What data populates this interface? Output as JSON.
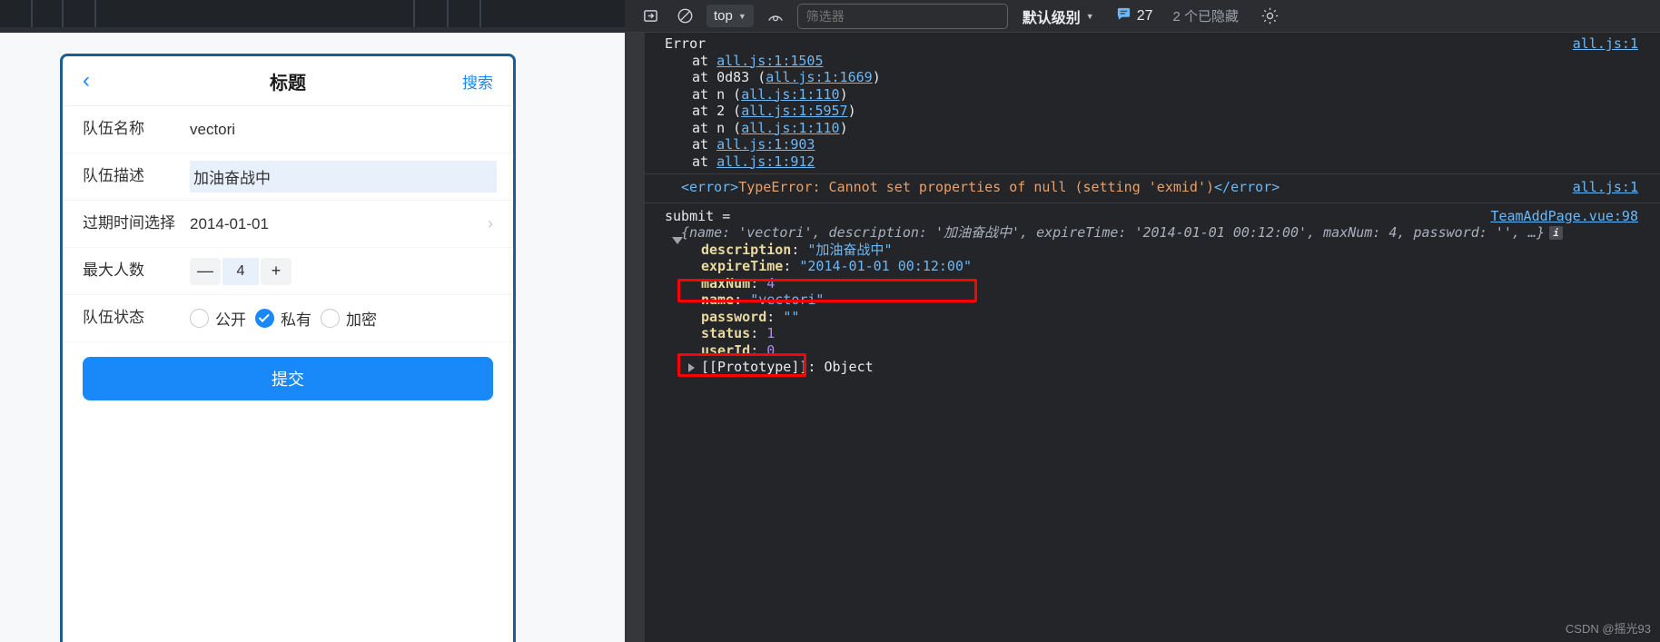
{
  "app": {
    "nav": {
      "back_icon": "chevron-left-icon",
      "title": "标题",
      "action": "搜索"
    },
    "fields": [
      {
        "label": "队伍名称",
        "value": "vectori"
      },
      {
        "label": "队伍描述",
        "value": "加油奋战中"
      },
      {
        "label": "过期时间选择",
        "value": "2014-01-01"
      },
      {
        "label": "最大人数",
        "value": "4"
      },
      {
        "label": "队伍状态"
      }
    ],
    "stepper": {
      "minus": "—",
      "plus": "+",
      "value": "4"
    },
    "status_options": [
      {
        "label": "公开",
        "checked": false
      },
      {
        "label": "私有",
        "checked": true
      },
      {
        "label": "加密",
        "checked": false
      }
    ],
    "submit_label": "提交",
    "accent_color": "#1989fa"
  },
  "devtools": {
    "toolbar": {
      "sidebar_icon": "console-sidebar-icon",
      "clear_icon": "clear-console-icon",
      "context": "top",
      "context_caret": "▼",
      "eye_icon": "live-expression-icon",
      "filter_placeholder": "筛选器",
      "filter_value": "",
      "level_label": "默认级别",
      "level_caret": "▼",
      "message_icon": "message-bubble-icon",
      "message_count": "27",
      "hidden_label": "2 个已隐藏",
      "gear_icon": "settings-gear-icon"
    },
    "messages": [
      {
        "title": "Error",
        "source": "all.js:1",
        "stack": [
          {
            "prefix": "at ",
            "fn": "",
            "link": "all.js:1:1505",
            "paren": false
          },
          {
            "prefix": "at ",
            "fn": "0d83 ",
            "link": "all.js:1:1669",
            "paren": true
          },
          {
            "prefix": "at ",
            "fn": "n ",
            "link": "all.js:1:110",
            "paren": true
          },
          {
            "prefix": "at ",
            "fn": "2 ",
            "link": "all.js:1:5957",
            "paren": true
          },
          {
            "prefix": "at ",
            "fn": "n ",
            "link": "all.js:1:110",
            "paren": true
          },
          {
            "prefix": "at ",
            "fn": "",
            "link": "all.js:1:903",
            "paren": false
          },
          {
            "prefix": "at ",
            "fn": "",
            "link": "all.js:1:912",
            "paren": false
          }
        ]
      },
      {
        "open_tag": "<error>",
        "text": "TypeError: Cannot set properties of null (setting 'exmid')",
        "close_tag": "</error>",
        "source": "all.js:1"
      }
    ],
    "object_log": {
      "label": "submit =",
      "source": "TeamAddPage.vue:98",
      "preview": "{name: 'vectori', description: '加油奋战中', expireTime: '2014-01-01 00:12:00', maxNum: 4, password: '', …}",
      "info_badge": "i",
      "properties": [
        {
          "name": "description",
          "value": "\"加油奋战中\"",
          "type": "string",
          "highlight": false
        },
        {
          "name": "expireTime",
          "value": "\"2014-01-01 00:12:00\"",
          "type": "string",
          "highlight": true
        },
        {
          "name": "maxNum",
          "value": "4",
          "type": "number",
          "highlight": false
        },
        {
          "name": "name",
          "value": "\"vectori\"",
          "type": "string",
          "highlight": false
        },
        {
          "name": "password",
          "value": "\"\"",
          "type": "string",
          "highlight": false
        },
        {
          "name": "status",
          "value": "1",
          "type": "number",
          "highlight": true
        },
        {
          "name": "userId",
          "value": "0",
          "type": "number",
          "highlight": false
        }
      ],
      "prototype_label": "[[Prototype]]: Object"
    },
    "prompt": "›",
    "highlight_color": "#ff0000"
  },
  "watermark": "CSDN @摇光93"
}
